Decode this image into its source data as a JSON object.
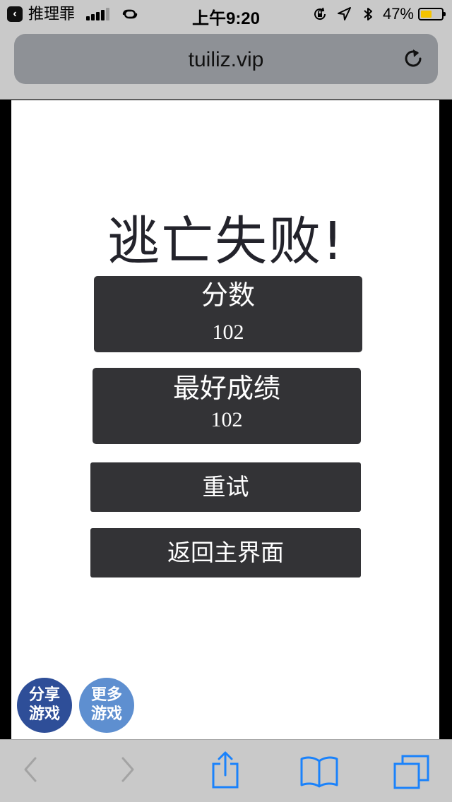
{
  "status_bar": {
    "back_app_label": "推理罪",
    "back_app_icon": "back-chevron",
    "time": "上午9:20",
    "battery_percent": "47%",
    "battery_level": 0.47,
    "battery_color": "#f5c400"
  },
  "address_bar": {
    "url": "tuiliz.vip"
  },
  "game": {
    "title": "逃亡失败!",
    "score": {
      "label": "分数",
      "value": "102"
    },
    "best": {
      "label": "最好成绩",
      "value": "102"
    },
    "retry_label": "重试",
    "home_label": "返回主界面",
    "share": {
      "line1": "分享",
      "line2": "游戏",
      "color": "#2e4e98"
    },
    "more": {
      "line1": "更多",
      "line2": "游戏",
      "color": "#5e8fd0"
    }
  },
  "toolbar": {
    "icons": [
      "back-icon",
      "forward-icon",
      "share-icon",
      "bookmarks-icon",
      "tabs-icon"
    ],
    "accent": "#1a82fb"
  }
}
